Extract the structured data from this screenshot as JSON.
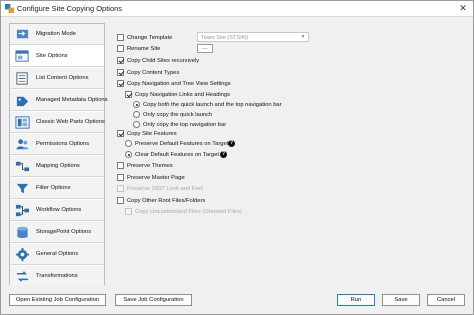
{
  "window": {
    "title": "Configure Site Copying Options",
    "close_glyph": "✕"
  },
  "nav": {
    "items": [
      {
        "label": "Migration Mode",
        "icon": "migration-mode-icon",
        "active": false
      },
      {
        "label": "Site Options",
        "icon": "site-options-icon",
        "active": true
      },
      {
        "label": "List Content Options",
        "icon": "list-content-icon",
        "active": false
      },
      {
        "label": "Managed Metadata Options",
        "icon": "managed-metadata-icon",
        "active": false
      },
      {
        "label": "Classic Web Parts Options",
        "icon": "web-parts-icon",
        "active": false
      },
      {
        "label": "Permissions Options",
        "icon": "permissions-icon",
        "active": false
      },
      {
        "label": "Mapping Options",
        "icon": "mapping-icon",
        "active": false
      },
      {
        "label": "Filter Options",
        "icon": "filter-icon",
        "active": false
      },
      {
        "label": "Workflow Options",
        "icon": "workflow-icon",
        "active": false
      },
      {
        "label": "StoragePoint Options",
        "icon": "storagepoint-icon",
        "active": false
      },
      {
        "label": "General Options",
        "icon": "general-options-icon",
        "active": false
      },
      {
        "label": "Transformations",
        "icon": "transformations-icon",
        "active": false
      }
    ]
  },
  "options": {
    "change_template": {
      "label": "Change Template",
      "checked": false
    },
    "template_select": {
      "value": "Team Site (STS#0)"
    },
    "rename_site": {
      "label": "Rename Site",
      "checked": false
    },
    "rename_button": {
      "label": "...."
    },
    "copy_child_sites": {
      "label": "Copy Child Sites recursively",
      "checked": true
    },
    "copy_content_types": {
      "label": "Copy Content Types",
      "checked": true
    },
    "copy_navigation": {
      "label": "Copy Navigation and Tree View Settings",
      "checked": true
    },
    "copy_nav_links": {
      "label": "Copy Navigation Links and Headings",
      "checked": true
    },
    "nav_both": {
      "label": "Copy both the quick launch and the top navigation bar",
      "checked": true
    },
    "nav_quick": {
      "label": "Only copy the quick launch",
      "checked": false
    },
    "nav_top": {
      "label": "Only copy the top navigation bar",
      "checked": false
    },
    "copy_site_features": {
      "label": "Copy Site Features",
      "checked": true
    },
    "preserve_default_features": {
      "label": "Preserve Default Features on Target",
      "checked": false
    },
    "clear_default_features": {
      "label": "Clear Default Features on Target",
      "checked": true
    },
    "preserve_themes": {
      "label": "Preserve Themes",
      "checked": false
    },
    "preserve_master_page": {
      "label": "Preserve Master Page",
      "checked": false
    },
    "preserve_2007": {
      "label": "Preserve 2007 Look and Feel",
      "checked": false
    },
    "copy_root_files": {
      "label": "Copy Other Root Files/Folders",
      "checked": false
    },
    "copy_ghosted": {
      "label": "Copy Uncustomized Files (Ghosted Files)",
      "checked": false
    },
    "help_glyph": "?"
  },
  "footer": {
    "open_job": "Open Existing Job Configuration",
    "save_job": "Save Job Configuration",
    "run": "Run",
    "save": "Save",
    "cancel": "Cancel"
  }
}
